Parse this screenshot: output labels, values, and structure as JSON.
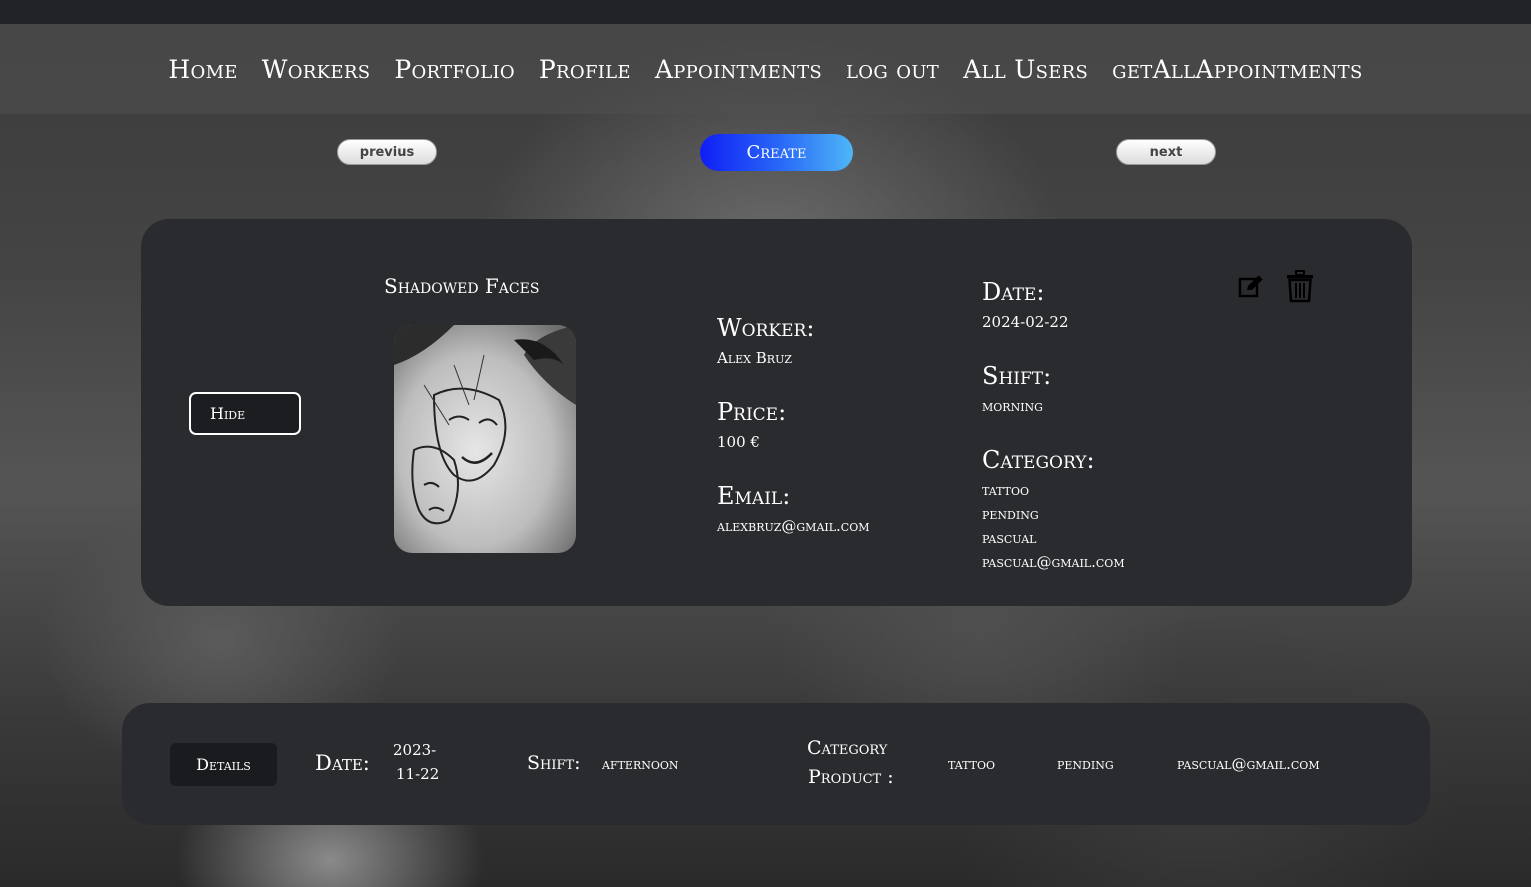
{
  "nav": {
    "items": [
      "Home",
      "Workers",
      "Portfolio",
      "Profile",
      "Appointments",
      "log out",
      "All Users",
      "getAllAppointments"
    ]
  },
  "pager": {
    "prev_label": "previus",
    "create_label": "Create",
    "next_label": "next"
  },
  "card": {
    "hide_label": "Hide",
    "portfolio_title": "Shadowed Faces",
    "worker_label": "Worker:",
    "worker_value": "Alex Bruz",
    "price_label": "Price:",
    "price_value": "100 €",
    "email_label": "Email:",
    "email_value": "alexbruz@gmail.com",
    "date_label": "Date:",
    "date_value": "2024-02-22",
    "shift_label": "Shift:",
    "shift_value": "morning",
    "category_label": "Category:",
    "category_values": [
      "tattoo",
      "pending",
      "pascual",
      "pascual@gmail.com"
    ],
    "edit_icon": "edit-icon",
    "delete_icon": "trash-icon"
  },
  "row": {
    "details_label": "Details",
    "date_label": "Date:",
    "date_value_1": "2023-",
    "date_value_2": "11-22",
    "shift_label": "Shift:",
    "shift_value": "afternoon",
    "category_label_1": "Category",
    "category_label_2": "Product :",
    "category_value": "tattoo",
    "status_value": "pending",
    "email_value": "pascual@gmail.com"
  }
}
